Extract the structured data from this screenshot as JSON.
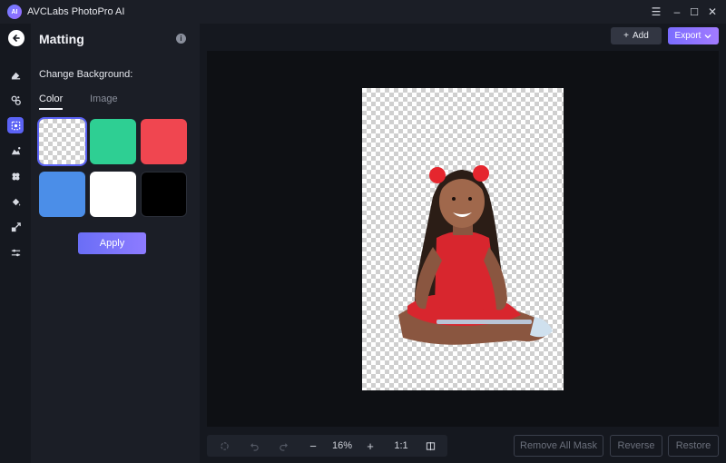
{
  "window": {
    "title": "AVCLabs PhotoPro AI",
    "logo_text": "AI",
    "controls": {
      "menu": "☰",
      "minimize": "–",
      "maximize": "☐",
      "close": "✕"
    }
  },
  "sidebar": {
    "items": [
      {
        "name": "eraser-icon"
      },
      {
        "name": "face-enhance-icon"
      },
      {
        "name": "matting-icon",
        "active": true
      },
      {
        "name": "object-remove-icon"
      },
      {
        "name": "colorize-icon"
      },
      {
        "name": "paint-bucket-icon"
      },
      {
        "name": "upscale-icon"
      },
      {
        "name": "adjust-icon"
      }
    ]
  },
  "panel": {
    "title": "Matting",
    "info_icon": "i",
    "section_label": "Change Background:",
    "tabs": [
      {
        "label": "Color",
        "active": true
      },
      {
        "label": "Image",
        "active": false
      }
    ],
    "swatches": [
      {
        "name": "transparent",
        "color": "transparent",
        "selected": true
      },
      {
        "name": "green",
        "color": "#2ecf93"
      },
      {
        "name": "red",
        "color": "#f04650"
      },
      {
        "name": "blue",
        "color": "#4b8ee8"
      },
      {
        "name": "white",
        "color": "#ffffff"
      },
      {
        "name": "black",
        "color": "#000000"
      }
    ],
    "apply_label": "Apply"
  },
  "toolbar": {
    "add_label": "Add",
    "add_icon": "+",
    "export_label": "Export"
  },
  "bottom": {
    "zoom_value": "16%",
    "zoom_minus": "−",
    "zoom_plus": "+",
    "ratio_label": "1:1",
    "remove_all_mask_label": "Remove All Mask",
    "reverse_label": "Reverse",
    "restore_label": "Restore"
  },
  "colors": {
    "accent": "#5b63f5",
    "panel_bg": "#1b1e26",
    "canvas_bg": "#0e1014"
  }
}
